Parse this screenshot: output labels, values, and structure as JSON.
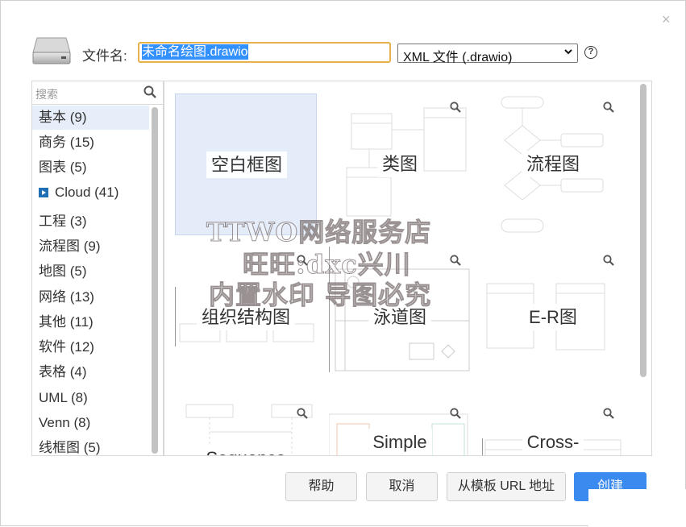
{
  "dialog": {
    "close_glyph": "×"
  },
  "file": {
    "label": "文件名:",
    "value": "未命名绘图.drawio",
    "format": "XML 文件 (.drawio)",
    "help_glyph": "?"
  },
  "sidebar": {
    "search_placeholder": "搜索",
    "items": [
      {
        "label": "基本 (9)"
      },
      {
        "label": "商务 (15)"
      },
      {
        "label": "图表 (5)"
      },
      {
        "label": "Cloud (41)"
      },
      {
        "label": "工程 (3)"
      },
      {
        "label": "流程图 (9)"
      },
      {
        "label": "地图 (5)"
      },
      {
        "label": "网络 (13)"
      },
      {
        "label": "其他 (11)"
      },
      {
        "label": "软件 (12)"
      },
      {
        "label": "表格 (4)"
      },
      {
        "label": "UML (8)"
      },
      {
        "label": "Venn (8)"
      },
      {
        "label": "线框图 (5)"
      }
    ],
    "selected_index": 0
  },
  "templates": [
    {
      "label": "空白框图"
    },
    {
      "label": "类图"
    },
    {
      "label": "流程图"
    },
    {
      "label": "组织结构图"
    },
    {
      "label": "泳道图"
    },
    {
      "label": "E-R图"
    },
    {
      "label": "Sequence"
    },
    {
      "label": "Simple"
    },
    {
      "label": "Cross-"
    }
  ],
  "buttons": {
    "help": "帮助",
    "cancel": "取消",
    "from_url": "从模板 URL 地址",
    "create": "创建"
  },
  "watermark": {
    "line1": "TTWO网络服务店",
    "line2": "旺旺:dxc兴川",
    "line3": "内置水印  导图必究"
  },
  "colors": {
    "primary": "#3a8af0",
    "selection": "#3390ff",
    "input_focus": "#e8b04b",
    "selected_bg": "#e3ecf8"
  }
}
